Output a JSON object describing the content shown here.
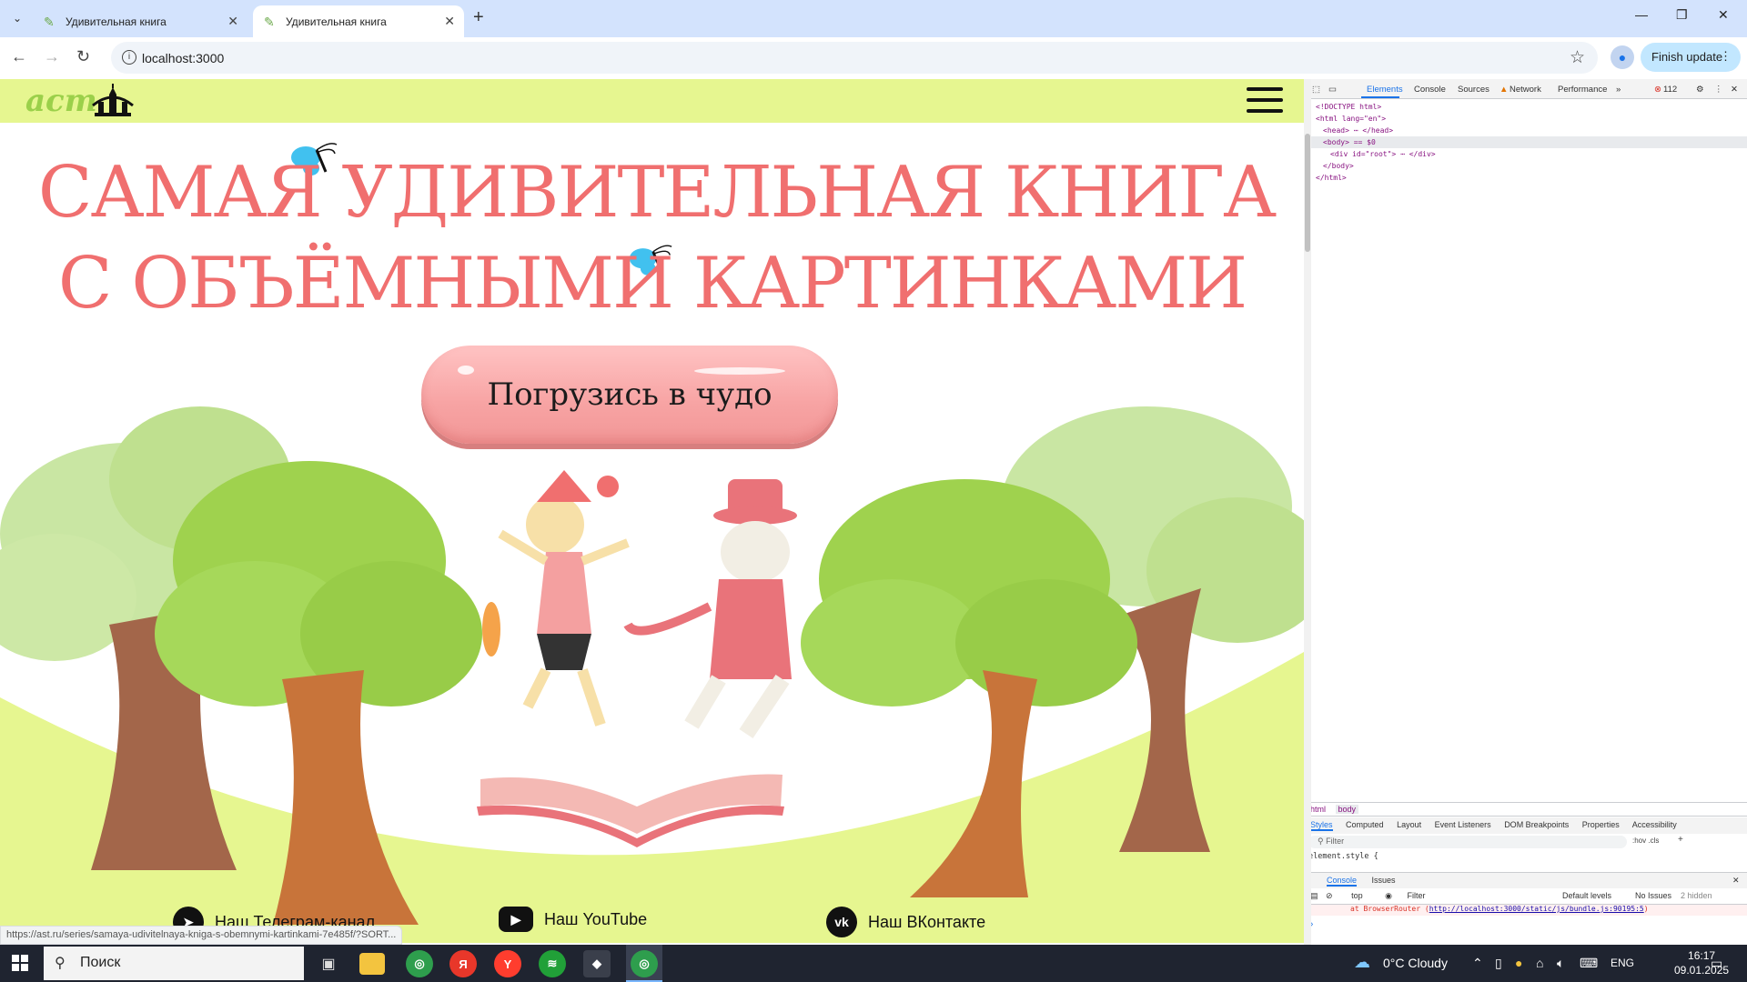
{
  "browser": {
    "tabs": [
      {
        "title": "Удивительная книга",
        "active": false
      },
      {
        "title": "Удивительная книга",
        "active": true
      }
    ],
    "url": "localhost:3000",
    "finish_update_label": "Finish update"
  },
  "site": {
    "logo_text": "аст",
    "title_line1": "САМАЯ УДИВИТЕЛЬНАЯ КНИГА",
    "title_line2": "С ОБЪЁМНЫМИ КАРТИНКАМИ",
    "cta_label": "Погрузись в чудо",
    "footer_links": [
      {
        "label": "Наш Телеграм-канал",
        "icon": "telegram-icon"
      },
      {
        "label": "Наш YouTube",
        "icon": "youtube-icon"
      },
      {
        "label": "Наш ВКонтакте",
        "icon": "vk-icon"
      }
    ],
    "status_url": "https://ast.ru/series/samaya-udivitelnaya-kniga-s-obemnymi-kartinkami-7e485f/?SORT...",
    "colors": {
      "header_bg": "#e6f690",
      "title": "#f06f6f",
      "cta": "#f7a3a3",
      "ground": "#e6f690"
    }
  },
  "devtools": {
    "tabs": [
      "Elements",
      "Console",
      "Sources",
      "Network",
      "Performance"
    ],
    "error_count": "112",
    "dom_lines": [
      "<!DOCTYPE html>",
      "<html lang=\"en\">",
      "<head> ⋯ </head>",
      "<body> == $0",
      "<div id=\"root\"> ⋯ </div>",
      "</body>",
      "</html>"
    ],
    "crumbs": [
      "html",
      "body"
    ],
    "style_tabs": [
      "Styles",
      "Computed",
      "Layout",
      "Event Listeners",
      "DOM Breakpoints",
      "Properties",
      "Accessibility"
    ],
    "filter_placeholder": "Filter",
    "filter_toggles": ":hov .cls",
    "element_style": "element.style {",
    "console_tabs": [
      "Console",
      "Issues"
    ],
    "console_context": "top",
    "console_filter": "Filter",
    "levels": "Default levels",
    "issues": "No Issues",
    "hidden": "2 hidden",
    "error_line_prefix": "at BrowserRouter (",
    "error_line_link": "http://localhost:3000/static/js/bundle.js:90195:5",
    "error_line_suffix": ")"
  },
  "taskbar": {
    "search_placeholder": "Поиск",
    "weather": "0°C  Cloudy",
    "lang": "ENG",
    "time": "16:17",
    "date": "09.01.2025"
  }
}
